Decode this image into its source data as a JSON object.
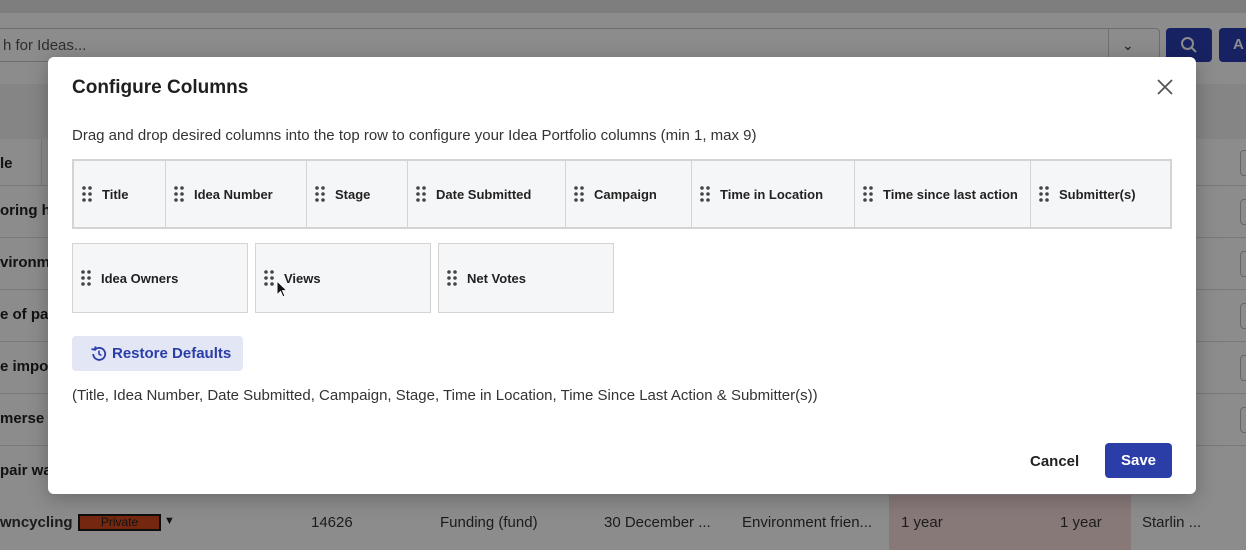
{
  "background": {
    "search_placeholder": "h for Ideas...",
    "add_button_label": "A",
    "header_title": "le",
    "row_titles": [
      "oring ha",
      "vironme",
      "e of pap",
      "e impor",
      "merse y",
      "pair wa"
    ],
    "last_row": {
      "title": "wncycling",
      "badge": "Private",
      "idea_number": "14626",
      "stage": "Funding (fund)",
      "date": "30 December ...",
      "campaign": "Environment frien...",
      "time_in_location": "1 year",
      "time_since_last_action": "1 year",
      "submitter": "Starlin ..."
    }
  },
  "modal": {
    "title": "Configure Columns",
    "instructions": "Drag and drop desired columns into the top row to configure your Idea Portfolio columns (min 1, max 9)",
    "selected_columns": [
      "Title",
      "Idea Number",
      "Stage",
      "Date Submitted",
      "Campaign",
      "Time in Location",
      "Time since last action",
      "Submitter(s)"
    ],
    "available_columns": [
      "Idea Owners",
      "Views",
      "Net Votes"
    ],
    "restore_label": "Restore Defaults",
    "defaults_note": "(Title, Idea Number, Date Submitted, Campaign, Stage, Time in Location, Time Since Last Action & Submitter(s))",
    "cancel_label": "Cancel",
    "save_label": "Save"
  },
  "colors": {
    "primary": "#2b3ea8",
    "restore_bg": "#e3e6f5",
    "chip_bg": "#f5f6f8",
    "badge": "#d64a1c",
    "row_highlight": "#f7dcdc"
  },
  "icons": [
    "search-icon",
    "chevron-down-icon",
    "close-icon",
    "grip-icon",
    "restore-icon",
    "cursor-icon"
  ]
}
